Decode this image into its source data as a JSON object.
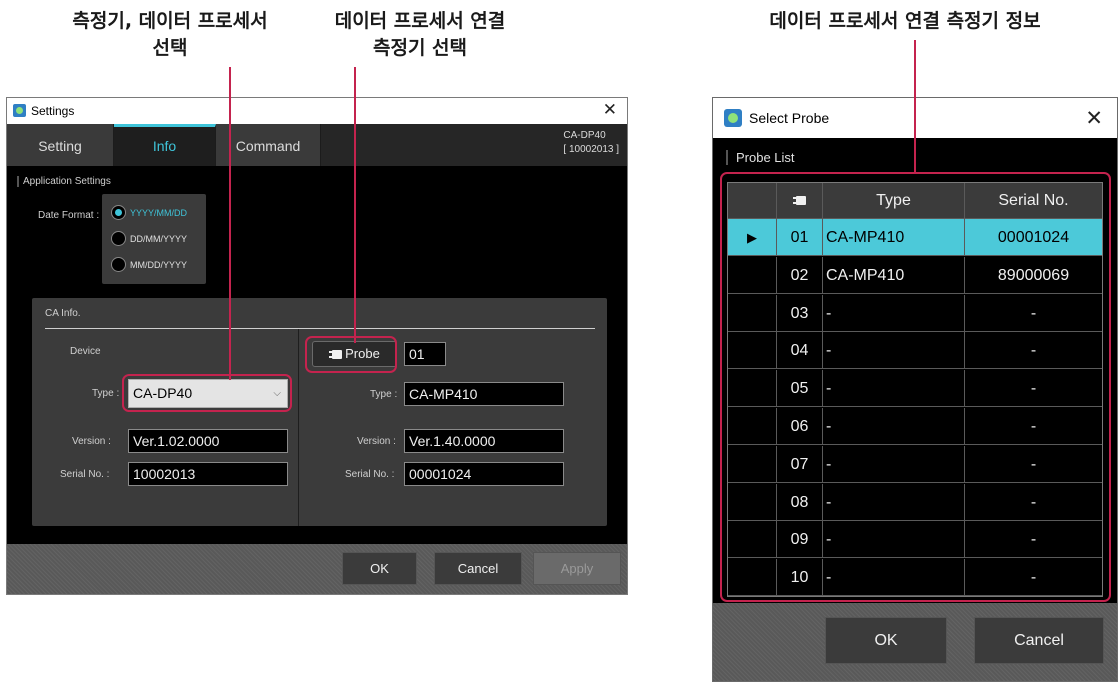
{
  "annotations": {
    "label_1": "측정기, 데이터 프로세서\n선택",
    "label_2": "데이터 프로세서 연결\n측정기 선택",
    "label_3": "데이터 프로세서 연결 측정기 정보"
  },
  "colors": {
    "annotation": "#c4234e",
    "accent": "#3fc4d9",
    "selected_row": "#4cc9d9"
  },
  "settings_window": {
    "title": "Settings",
    "tabs": [
      "Setting",
      "Info",
      "Command"
    ],
    "active_tab": "Info",
    "device_id_line1": "CA-DP40",
    "device_id_line2": "[ 10002013 ]",
    "application_settings_label": "Application Settings",
    "date_format_label": "Date Format :",
    "date_formats": [
      "YYYY/MM/DD",
      "DD/MM/YYYY",
      "MM/DD/YYYY"
    ],
    "selected_date_format": "YYYY/MM/DD",
    "ca_info_label": "CA Info.",
    "device_label": "Device",
    "device": {
      "type_label": "Type :",
      "type_value": "CA-DP40",
      "version_label": "Version :",
      "version_value": "Ver.1.02.0000",
      "serial_label": "Serial No. :",
      "serial_value": "10002013"
    },
    "probe_button_label": "Probe",
    "probe_number": "01",
    "probe": {
      "type_label": "Type :",
      "type_value": "CA-MP410",
      "version_label": "Version :",
      "version_value": "Ver.1.40.0000",
      "serial_label": "Serial No. :",
      "serial_value": "00001024"
    },
    "buttons": {
      "ok": "OK",
      "cancel": "Cancel",
      "apply": "Apply"
    }
  },
  "probe_window": {
    "title": "Select Probe",
    "list_label": "Probe List",
    "columns": [
      "",
      "Type",
      "Serial No."
    ],
    "rows": [
      {
        "no": "01",
        "type": "CA-MP410",
        "serial": "00001024",
        "selected": true
      },
      {
        "no": "02",
        "type": "CA-MP410",
        "serial": "89000069",
        "selected": false
      },
      {
        "no": "03",
        "type": "-",
        "serial": "-",
        "selected": false
      },
      {
        "no": "04",
        "type": "-",
        "serial": "-",
        "selected": false
      },
      {
        "no": "05",
        "type": "-",
        "serial": "-",
        "selected": false
      },
      {
        "no": "06",
        "type": "-",
        "serial": "-",
        "selected": false
      },
      {
        "no": "07",
        "type": "-",
        "serial": "-",
        "selected": false
      },
      {
        "no": "08",
        "type": "-",
        "serial": "-",
        "selected": false
      },
      {
        "no": "09",
        "type": "-",
        "serial": "-",
        "selected": false
      },
      {
        "no": "10",
        "type": "-",
        "serial": "-",
        "selected": false
      }
    ],
    "buttons": {
      "ok": "OK",
      "cancel": "Cancel"
    }
  }
}
